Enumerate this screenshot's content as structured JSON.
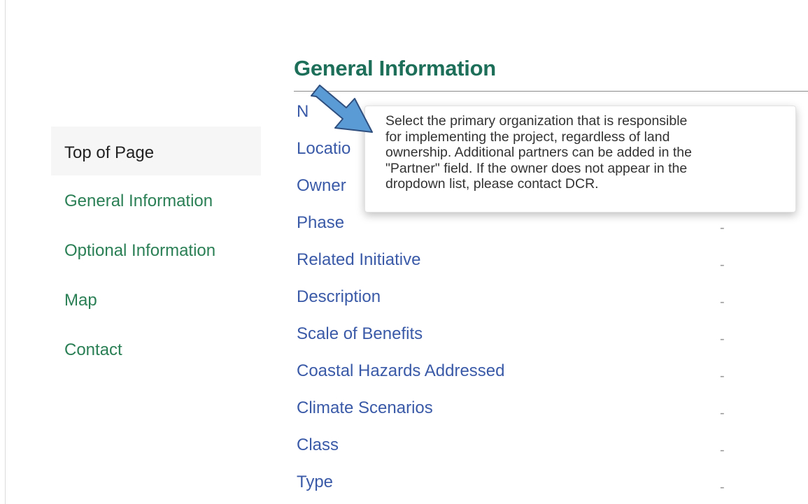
{
  "sidebar": {
    "items": [
      {
        "label": "Top of Page",
        "active": true
      },
      {
        "label": "General Information"
      },
      {
        "label": "Optional Information"
      },
      {
        "label": "Map"
      },
      {
        "label": "Contact"
      }
    ]
  },
  "main": {
    "section_title": "General Information",
    "fields": [
      {
        "label": "N",
        "value": ""
      },
      {
        "label": "Locatio",
        "value": ""
      },
      {
        "label": "Owner",
        "value": ""
      },
      {
        "label": "Phase",
        "value": "-"
      },
      {
        "label": "Related Initiative",
        "value": "-"
      },
      {
        "label": "Description",
        "value": "-"
      },
      {
        "label": "Scale of Benefits",
        "value": "-"
      },
      {
        "label": "Coastal Hazards Addressed",
        "value": "-"
      },
      {
        "label": "Climate Scenarios",
        "value": "-"
      },
      {
        "label": "Class",
        "value": "-"
      },
      {
        "label": "Type",
        "value": "-"
      }
    ]
  },
  "tooltip": {
    "text": "Select the primary organization that is responsible\nfor implementing the project, regardless of land\nownership.  Additional partners can be added in the\n\"Partner\" field.  If the owner does not appear in the\ndropdown list, please contact DCR."
  },
  "colors": {
    "nav_link": "#2a7f55",
    "section_title": "#1d6f5a",
    "field_label": "#3a5aa8",
    "arrow_fill": "#5b9bd5",
    "arrow_stroke": "#2f4f7f"
  },
  "icons": {
    "pointer": "arrow-icon"
  }
}
